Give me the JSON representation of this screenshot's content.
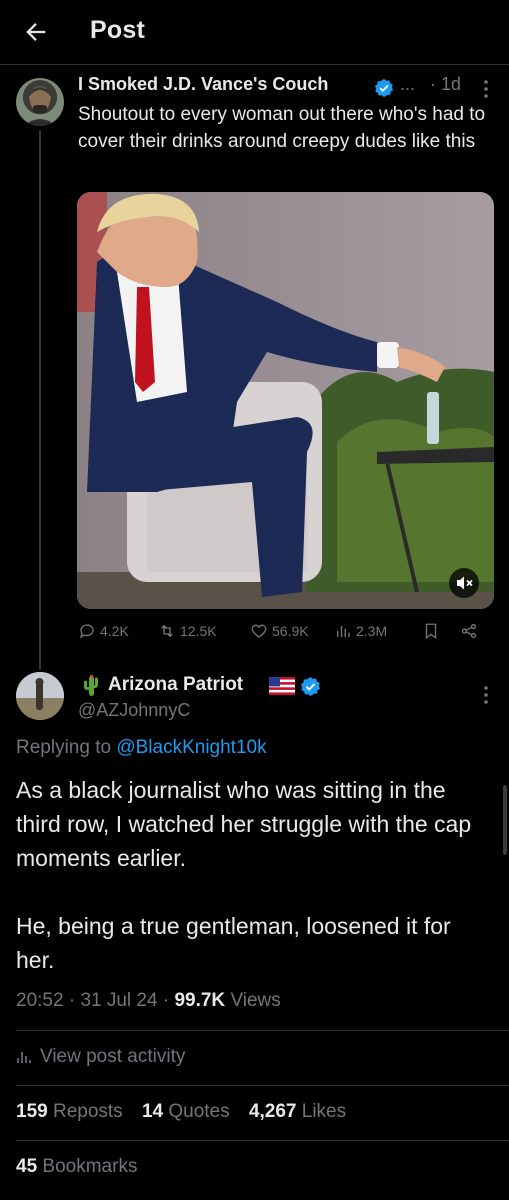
{
  "header": {
    "title": "Post"
  },
  "parent_post": {
    "author_name": "I Smoked J.D. Vance's Couch",
    "truncation": "...",
    "time": "· 1d",
    "text": "Shoutout to every woman out there who's had to cover their drinks around creepy dudes like this",
    "stats": {
      "replies": "4.2K",
      "reposts": "12.5K",
      "likes": "56.9K",
      "views": "2.3M"
    }
  },
  "reply": {
    "author_name": "Arizona Patriot",
    "handle": "@AZJohnnyC",
    "replying_prefix": "Replying to",
    "replying_to": "@BlackKnight10k",
    "paragraphs": [
      "As a black journalist who was sitting in the third row, I watched her struggle with the cap moments earlier.",
      "He, being a true gentleman, loosened it for her."
    ],
    "time": "20:52",
    "date": "31 Jul 24",
    "views_count": "99.7K",
    "views_label": "Views",
    "activity_label": "View post activity",
    "reposts_count": "159",
    "reposts_label": "Reposts",
    "quotes_count": "14",
    "quotes_label": "Quotes",
    "likes_count": "4,267",
    "likes_label": "Likes",
    "bookmarks_count": "45",
    "bookmarks_label": "Bookmarks"
  },
  "colors": {
    "accent": "#1d9bf0",
    "muted": "#71767b",
    "text": "#e7e9ea",
    "background": "#000000"
  }
}
